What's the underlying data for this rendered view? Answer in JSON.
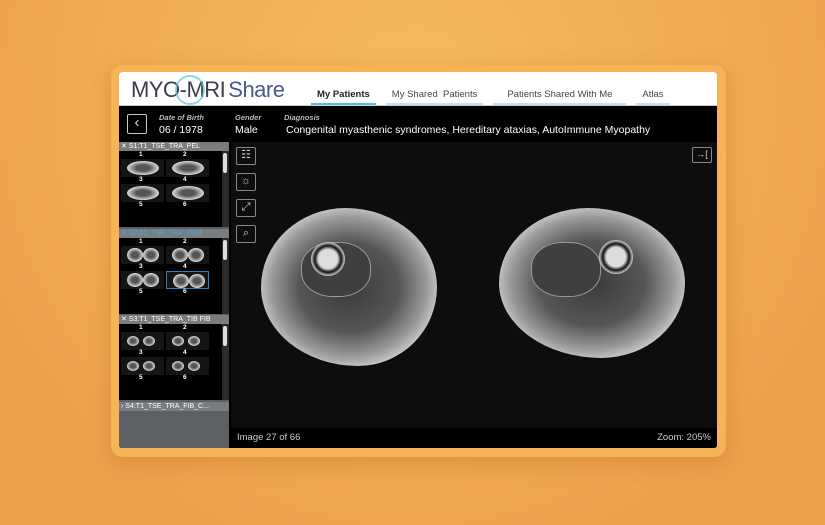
{
  "header": {
    "logo": "MYO-MRI",
    "logo_suffix": "Share",
    "tabs": [
      {
        "label": "My Patients",
        "active": true
      },
      {
        "label": "My Shared  Patients"
      },
      {
        "label": "Patients Shared With Me"
      },
      {
        "label": "Atlas"
      }
    ]
  },
  "patient": {
    "dob_label": "Date of Birth",
    "dob": "06 / 1978",
    "gender_label": "Gender",
    "gender": "Male",
    "diagnosis_label": "Diagnosis",
    "diagnosis": "Congenital myasthenic syndromes, Hereditary ataxias, AutoImmune Myopathy"
  },
  "series": [
    {
      "title": "S1:T1_TSE_TRA_PEL",
      "nums": [
        "1",
        "2",
        "3",
        "4",
        "5",
        "6"
      ]
    },
    {
      "title": "S2:T1_TSE_TRA_FEM",
      "nums": [
        "1",
        "2",
        "3",
        "4",
        "5",
        "6"
      ],
      "selected_thumb": "4"
    },
    {
      "title": "S3:T1_TSE_TRA_TIB FIB",
      "nums": [
        "1",
        "2",
        "3",
        "4",
        "5",
        "6"
      ]
    },
    {
      "title": "S4:T1_TSE_TRA_FIB_C..."
    }
  ],
  "viewer": {
    "image_status": "Image 27 of 66",
    "zoom": "Zoom: 205%"
  },
  "colors": {
    "accent": "#4cc2d8",
    "selected": "#4aa8e6",
    "frame": "#f7b457"
  }
}
